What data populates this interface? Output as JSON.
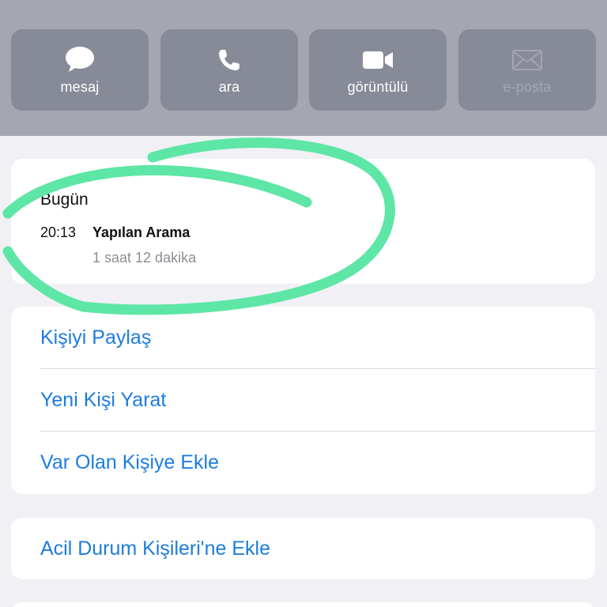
{
  "actions": {
    "message": {
      "label": "mesaj",
      "icon": "message-bubble-icon"
    },
    "call": {
      "label": "ara",
      "icon": "phone-icon"
    },
    "video": {
      "label": "görüntülü",
      "icon": "video-camera-icon"
    },
    "email": {
      "label": "e-posta",
      "icon": "envelope-icon",
      "disabled": true
    }
  },
  "recents": {
    "day": "Bugün",
    "calls": [
      {
        "time": "20:13",
        "type": "Yapılan Arama",
        "duration": "1 saat 12 dakika"
      }
    ]
  },
  "contact_actions": [
    {
      "label": "Kişiyi Paylaş"
    },
    {
      "label": "Yeni Kişi Yarat"
    },
    {
      "label": "Var Olan Kişiye Ekle"
    }
  ],
  "emergency": {
    "label": "Acil Durum Kişileri'ne Ekle"
  },
  "colors": {
    "link": "#1c7ce0",
    "annotation": "#5ee6a6",
    "header_bg": "#a4a6b0",
    "button_bg": "#878b98"
  }
}
